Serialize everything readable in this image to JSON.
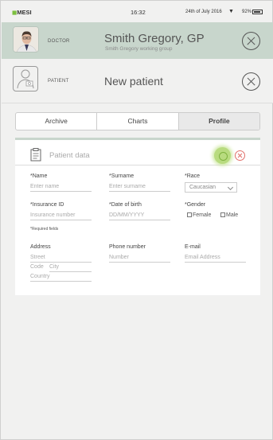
{
  "status_bar": {
    "brand": "MESI",
    "time": "16:32",
    "date": "24th of July 2016",
    "battery": "92%"
  },
  "doctor": {
    "role": "DOCTOR",
    "name": "Smith Gregory, GP",
    "group": "Smith Gregory working group"
  },
  "patient": {
    "role": "PATIENT",
    "name": "New patient"
  },
  "tabs": [
    {
      "label": "Archive",
      "active": false
    },
    {
      "label": "Charts",
      "active": false
    },
    {
      "label": "Profile",
      "active": true
    }
  ],
  "form": {
    "title": "Patient data",
    "name": {
      "label": "*Name",
      "placeholder": "Enter name"
    },
    "surname": {
      "label": "*Surname",
      "placeholder": "Enter surname"
    },
    "race": {
      "label": "*Race",
      "value": "Caucasian"
    },
    "insurance": {
      "label": "*Insurance ID",
      "placeholder": "Insurance number"
    },
    "dob": {
      "label": "*Date of birth",
      "placeholder": "DD/MM/YYYY"
    },
    "gender": {
      "label": "*Gender",
      "female": "Female",
      "male": "Male"
    },
    "required_note": "*Required fields",
    "address": {
      "label": "Address",
      "street": "Street",
      "code": "Code",
      "city": "City",
      "country": "Country"
    },
    "phone": {
      "label": "Phone number",
      "placeholder": "Number"
    },
    "email": {
      "label": "E-mail",
      "placeholder": "Email Address"
    }
  },
  "colors": {
    "doctor_bar": "#c8d6cc",
    "confirm": "#b8db7f",
    "cancel": "#e1706a",
    "brand": "#7cbf3f"
  }
}
